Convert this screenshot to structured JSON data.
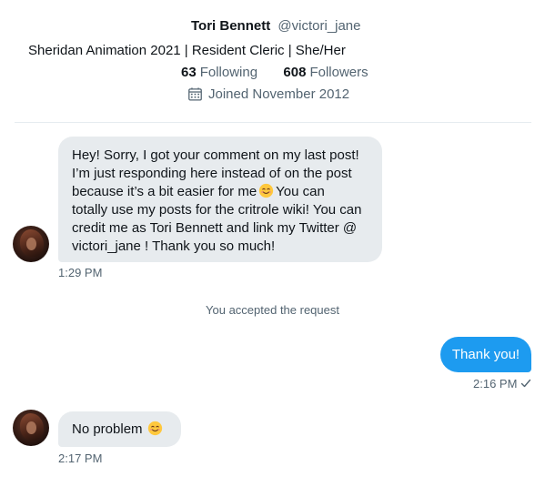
{
  "profile": {
    "display_name": "Tori Bennett",
    "handle": "@victori_jane",
    "bio": "Sheridan Animation 2021 | Resident Cleric | She/Her",
    "following_count": "63",
    "following_label": "Following",
    "followers_count": "608",
    "followers_label": "Followers",
    "joined": "Joined November 2012",
    "joined_icon": "calendar-icon"
  },
  "messages": [
    {
      "direction": "incoming",
      "lines": [
        "Hey! Sorry, I got your comment on my last post!",
        "I’m just responding here instead of on the post",
        "because it’s a bit easier for me",
        "You can",
        "totally use my posts for the critrole wiki! You can",
        "credit me as Tori Bennett and link my Twitter @",
        "victori_jane ! Thank you so much!"
      ],
      "time": "1:29 PM"
    },
    {
      "direction": "system",
      "text": "You accepted the request"
    },
    {
      "direction": "outgoing",
      "text": "Thank you!",
      "time": "2:16 PM"
    },
    {
      "direction": "incoming",
      "text": "No problem",
      "time": "2:17 PM"
    }
  ],
  "icons": {
    "emoji": "smiling-face-emoji",
    "sent_status": "check-icon"
  },
  "colors": {
    "accent": "#1d9bf0",
    "incoming_bubble": "#e7ebee",
    "muted_text": "#536471"
  }
}
